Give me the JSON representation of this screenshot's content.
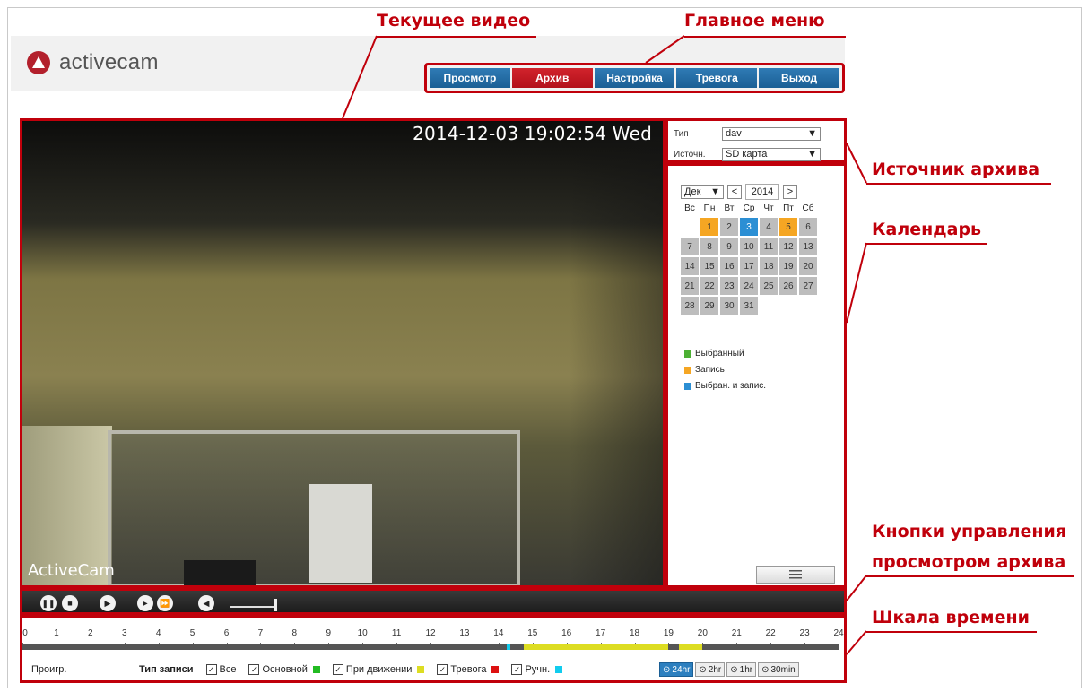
{
  "logo": {
    "text": "activecam"
  },
  "menu": [
    {
      "label": "Просмотр",
      "active": false
    },
    {
      "label": "Архив",
      "active": true
    },
    {
      "label": "Настройка",
      "active": false
    },
    {
      "label": "Тревога",
      "active": false
    },
    {
      "label": "Выход",
      "active": false
    }
  ],
  "video": {
    "timestamp": "2014-12-03 19:02:54 Wed",
    "channel_name": "ActiveCam"
  },
  "source": {
    "type_label": "Тип",
    "type_value": "dav",
    "source_label": "Источн.",
    "source_value": "SD карта"
  },
  "calendar": {
    "month": "Дек",
    "year": "2014",
    "prev": "<",
    "next": ">",
    "weekdays": [
      "Вс",
      "Пн",
      "Вт",
      "Ср",
      "Чт",
      "Пт",
      "Сб"
    ],
    "recorded_days": [
      1,
      5
    ],
    "selected_recorded_day": 3,
    "legend": [
      {
        "label": "Выбранный",
        "color": "#4cb034"
      },
      {
        "label": "Запись",
        "color": "#f5a623"
      },
      {
        "label": "Выбран. и запис.",
        "color": "#2c8fd4"
      }
    ]
  },
  "controls": [
    "pause",
    "stop",
    "play",
    "slow",
    "fast",
    "volume"
  ],
  "timeline": {
    "hours": [
      "0",
      "1",
      "2",
      "3",
      "4",
      "5",
      "6",
      "7",
      "8",
      "9",
      "10",
      "11",
      "12",
      "13",
      "14",
      "15",
      "16",
      "17",
      "18",
      "19",
      "20",
      "21",
      "22",
      "23",
      "24"
    ],
    "play_label": "Проигр.",
    "record_type_label": "Тип записи",
    "filters": [
      {
        "label": "Все",
        "color": ""
      },
      {
        "label": "Основной",
        "color": "#22bb22"
      },
      {
        "label": "При движении",
        "color": "#dddd22"
      },
      {
        "label": "Тревога",
        "color": "#dd1111"
      },
      {
        "label": "Ручн.",
        "color": "#11ccee"
      }
    ],
    "zoom": [
      {
        "label": "24hr",
        "active": true
      },
      {
        "label": "2hr",
        "active": false
      },
      {
        "label": "1hr",
        "active": false
      },
      {
        "label": "30min",
        "active": false
      }
    ],
    "recordings": [
      {
        "start_hour": 14.25,
        "end_hour": 14.35,
        "color": "#11ccee"
      },
      {
        "start_hour": 14.75,
        "end_hour": 19.0,
        "color": "#dddd22"
      },
      {
        "start_hour": 19.3,
        "end_hour": 20.0,
        "color": "#dddd22"
      }
    ]
  },
  "annotations": {
    "current_video": "Текущее видео",
    "main_menu": "Главное меню",
    "archive_source": "Источник архива",
    "calendar": "Календарь",
    "playback_buttons_1": "Кнопки управления",
    "playback_buttons_2": "просмотром архива",
    "timeline": "Шкала времени"
  }
}
